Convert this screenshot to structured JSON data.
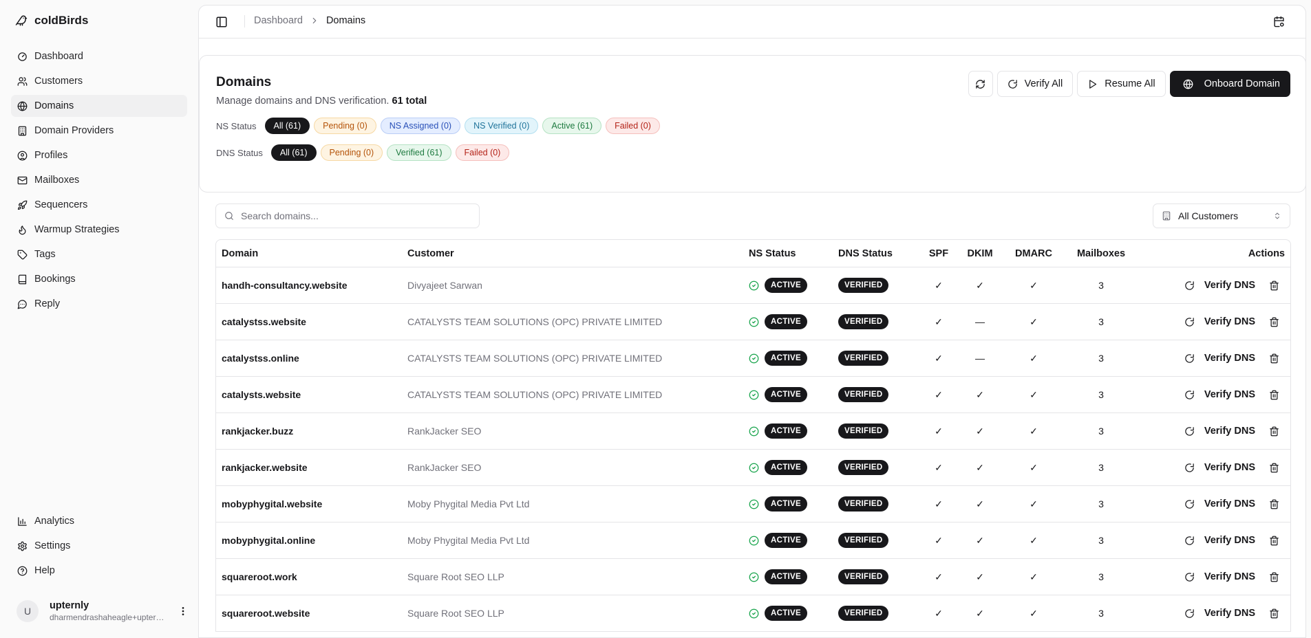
{
  "app": {
    "name": "coldBirds"
  },
  "sidebar": {
    "items": [
      {
        "label": "Dashboard",
        "icon": "gauge-icon",
        "active": false
      },
      {
        "label": "Customers",
        "icon": "users-icon",
        "active": false
      },
      {
        "label": "Domains",
        "icon": "globe-icon",
        "active": true
      },
      {
        "label": "Domain Providers",
        "icon": "server-icon",
        "active": false
      },
      {
        "label": "Profiles",
        "icon": "user-circle-icon",
        "active": false
      },
      {
        "label": "Mailboxes",
        "icon": "mail-icon",
        "active": false
      },
      {
        "label": "Sequencers",
        "icon": "rocket-icon",
        "active": false
      },
      {
        "label": "Warmup Strategies",
        "icon": "flame-icon",
        "active": false
      },
      {
        "label": "Tags",
        "icon": "tag-icon",
        "active": false
      },
      {
        "label": "Bookings",
        "icon": "book-icon",
        "active": false
      },
      {
        "label": "Reply",
        "icon": "message-icon",
        "active": false
      }
    ],
    "bottom_items": [
      {
        "label": "Analytics",
        "icon": "bar-chart-icon"
      },
      {
        "label": "Settings",
        "icon": "gear-icon"
      },
      {
        "label": "Help",
        "icon": "help-icon"
      }
    ],
    "user": {
      "initial": "U",
      "name": "upternly",
      "email": "dharmendrashaheagle+upternly@gmail.com"
    }
  },
  "breadcrumb": {
    "parent": "Dashboard",
    "current": "Domains"
  },
  "header": {
    "title": "Domains",
    "subtitle": "Manage domains and DNS verification.",
    "total": "61 total",
    "buttons": {
      "verify_all": "Verify All",
      "resume_all": "Resume All",
      "onboard": "Onboard Domain"
    }
  },
  "filters": {
    "ns_label": "NS Status",
    "ns": [
      {
        "label": "All (61)",
        "style": "sel"
      },
      {
        "label": "Pending (0)",
        "style": "p-pending"
      },
      {
        "label": "NS Assigned (0)",
        "style": "p-nsassigned"
      },
      {
        "label": "NS Verified (0)",
        "style": "p-nsverified"
      },
      {
        "label": "Active (61)",
        "style": "p-active"
      },
      {
        "label": "Failed (0)",
        "style": "p-failed"
      }
    ],
    "dns_label": "DNS Status",
    "dns": [
      {
        "label": "All (61)",
        "style": "sel"
      },
      {
        "label": "Pending (0)",
        "style": "p-pending"
      },
      {
        "label": "Verified (61)",
        "style": "p-active"
      },
      {
        "label": "Failed (0)",
        "style": "p-failed"
      }
    ]
  },
  "search": {
    "placeholder": "Search domains...",
    "value": ""
  },
  "customer_filter": {
    "selected": "All Customers"
  },
  "table": {
    "columns": [
      "Domain",
      "Customer",
      "NS Status",
      "DNS Status",
      "SPF",
      "DKIM",
      "DMARC",
      "Mailboxes",
      "Actions"
    ],
    "action_label": "Verify DNS",
    "rows": [
      {
        "domain": "handh-consultancy.website",
        "customer": "Divyajeet Sarwan",
        "ns": "ACTIVE",
        "dns": "VERIFIED",
        "spf": "✓",
        "dkim": "✓",
        "dmarc": "✓",
        "mailboxes": "3"
      },
      {
        "domain": "catalystss.website",
        "customer": "CATALYSTS TEAM SOLUTIONS (OPC) PRIVATE LIMITED",
        "ns": "ACTIVE",
        "dns": "VERIFIED",
        "spf": "✓",
        "dkim": "—",
        "dmarc": "✓",
        "mailboxes": "3"
      },
      {
        "domain": "catalystss.online",
        "customer": "CATALYSTS TEAM SOLUTIONS (OPC) PRIVATE LIMITED",
        "ns": "ACTIVE",
        "dns": "VERIFIED",
        "spf": "✓",
        "dkim": "—",
        "dmarc": "✓",
        "mailboxes": "3"
      },
      {
        "domain": "catalysts.website",
        "customer": "CATALYSTS TEAM SOLUTIONS (OPC) PRIVATE LIMITED",
        "ns": "ACTIVE",
        "dns": "VERIFIED",
        "spf": "✓",
        "dkim": "✓",
        "dmarc": "✓",
        "mailboxes": "3"
      },
      {
        "domain": "rankjacker.buzz",
        "customer": "RankJacker SEO",
        "ns": "ACTIVE",
        "dns": "VERIFIED",
        "spf": "✓",
        "dkim": "✓",
        "dmarc": "✓",
        "mailboxes": "3"
      },
      {
        "domain": "rankjacker.website",
        "customer": "RankJacker SEO",
        "ns": "ACTIVE",
        "dns": "VERIFIED",
        "spf": "✓",
        "dkim": "✓",
        "dmarc": "✓",
        "mailboxes": "3"
      },
      {
        "domain": "mobyphygital.website",
        "customer": "Moby Phygital Media Pvt Ltd",
        "ns": "ACTIVE",
        "dns": "VERIFIED",
        "spf": "✓",
        "dkim": "✓",
        "dmarc": "✓",
        "mailboxes": "3"
      },
      {
        "domain": "mobyphygital.online",
        "customer": "Moby Phygital Media Pvt Ltd",
        "ns": "ACTIVE",
        "dns": "VERIFIED",
        "spf": "✓",
        "dkim": "✓",
        "dmarc": "✓",
        "mailboxes": "3"
      },
      {
        "domain": "squareroot.work",
        "customer": "Square Root SEO LLP",
        "ns": "ACTIVE",
        "dns": "VERIFIED",
        "spf": "✓",
        "dkim": "✓",
        "dmarc": "✓",
        "mailboxes": "3"
      },
      {
        "domain": "squareroot.website",
        "customer": "Square Root SEO LLP",
        "ns": "ACTIVE",
        "dns": "VERIFIED",
        "spf": "✓",
        "dkim": "✓",
        "dmarc": "✓",
        "mailboxes": "3"
      }
    ]
  },
  "colors": {
    "accent": "#18181b",
    "success": "#16a34a"
  }
}
